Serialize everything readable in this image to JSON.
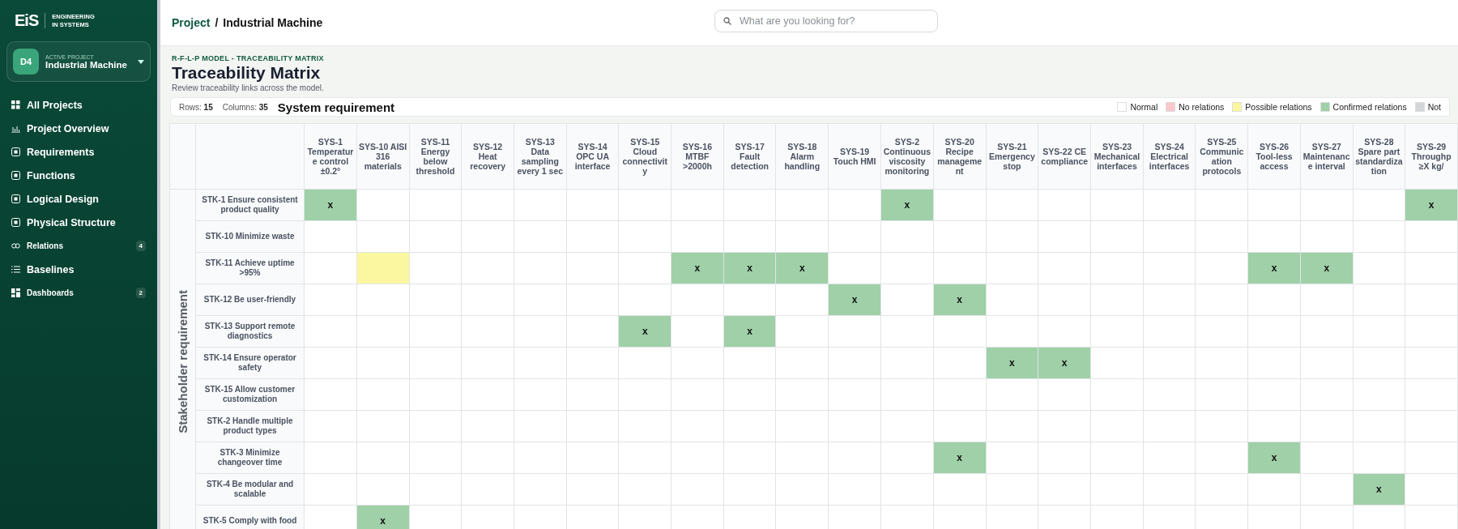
{
  "brand": {
    "logo": "EiS",
    "tagline_1": "ENGINEERING",
    "tagline_2": "IN SYSTEMS"
  },
  "project": {
    "avatar": "D4",
    "caption": "ACTIVE PROJECT",
    "name": "Industrial Machine"
  },
  "sidebar": {
    "items": [
      {
        "label": "All Projects",
        "kind": "main"
      },
      {
        "label": "Project Overview",
        "kind": "main"
      },
      {
        "label": "Requirements",
        "kind": "main"
      },
      {
        "label": "Functions",
        "kind": "main"
      },
      {
        "label": "Logical Design",
        "kind": "main"
      },
      {
        "label": "Physical Structure",
        "kind": "main"
      },
      {
        "label": "Relations",
        "kind": "compact",
        "badge": "4"
      },
      {
        "label": "Baselines",
        "kind": "main"
      },
      {
        "label": "Dashboards",
        "kind": "compact",
        "badge": "2"
      }
    ]
  },
  "breadcrumb": {
    "parent": "Project",
    "separator": "/",
    "current": "Industrial Machine"
  },
  "search": {
    "placeholder": "What are you looking for?"
  },
  "header": {
    "eyebrow": "R-F-L-P MODEL - TRACEABILITY MATRIX",
    "title": "Traceability Matrix",
    "subtitle": "Review traceability links across the model."
  },
  "toolbar": {
    "rows_label": "Rows:",
    "rows": "15",
    "columns_label": "Columns:",
    "columns": "35",
    "axis_title": "System requirement"
  },
  "legend": [
    {
      "label": "Normal",
      "color": "#ffffff"
    },
    {
      "label": "No relations",
      "color": "#f8c8cc"
    },
    {
      "label": "Possible relations",
      "color": "#fbf7a0"
    },
    {
      "label": "Confirmed relations",
      "color": "#9fd0a8"
    },
    {
      "label": "Not",
      "color": "#d4d6d8"
    }
  ],
  "matrix": {
    "row_axis": "Stakeholder requirement",
    "columns": [
      "SYS-1 Temperature control ±0.2°",
      "SYS-10 AISI 316 materials",
      "SYS-11 Energy below threshold",
      "SYS-12 Heat recovery",
      "SYS-13 Data sampling every 1 sec",
      "SYS-14 OPC UA interface",
      "SYS-15 Cloud connectivity",
      "SYS-16 MTBF >2000h",
      "SYS-17 Fault detection",
      "SYS-18 Alarm handling",
      "SYS-19 Touch HMI",
      "SYS-2 Continuous viscosity monitoring",
      "SYS-20 Recipe management",
      "SYS-21 Emergency stop",
      "SYS-22 CE compliance",
      "SYS-23 Mechanical interfaces",
      "SYS-24 Electrical interfaces",
      "SYS-25 Communication protocols",
      "SYS-26 Tool-less access",
      "SYS-27 Maintenance interval",
      "SYS-28 Spare part standardization",
      "SYS-29 Throughp ≥X kg/"
    ],
    "rows": [
      {
        "label": "STK-1 Ensure consistent product quality",
        "cells": [
          {
            "kind": "confirmed",
            "text": "x"
          },
          {
            "kind": "normal"
          },
          {
            "kind": "normal"
          },
          {
            "kind": "normal"
          },
          {
            "kind": "normal"
          },
          {
            "kind": "normal"
          },
          {
            "kind": "normal"
          },
          {
            "kind": "normal"
          },
          {
            "kind": "normal"
          },
          {
            "kind": "normal"
          },
          {
            "kind": "normal"
          },
          {
            "kind": "confirmed",
            "text": "x"
          },
          {
            "kind": "normal"
          },
          {
            "kind": "normal"
          },
          {
            "kind": "normal"
          },
          {
            "kind": "normal"
          },
          {
            "kind": "normal"
          },
          {
            "kind": "normal"
          },
          {
            "kind": "normal"
          },
          {
            "kind": "normal"
          },
          {
            "kind": "normal"
          },
          {
            "kind": "confirmed",
            "text": "x"
          }
        ]
      },
      {
        "label": "STK-10 Minimize waste",
        "cells": [
          {
            "kind": "normal"
          },
          {
            "kind": "normal"
          },
          {
            "kind": "normal"
          },
          {
            "kind": "normal"
          },
          {
            "kind": "normal"
          },
          {
            "kind": "normal"
          },
          {
            "kind": "normal"
          },
          {
            "kind": "normal"
          },
          {
            "kind": "normal"
          },
          {
            "kind": "normal"
          },
          {
            "kind": "normal"
          },
          {
            "kind": "normal"
          },
          {
            "kind": "normal"
          },
          {
            "kind": "normal"
          },
          {
            "kind": "normal"
          },
          {
            "kind": "normal"
          },
          {
            "kind": "normal"
          },
          {
            "kind": "normal"
          },
          {
            "kind": "normal"
          },
          {
            "kind": "normal"
          },
          {
            "kind": "normal"
          },
          {
            "kind": "normal"
          }
        ]
      },
      {
        "label": "STK-11 Achieve uptime >95%",
        "cells": [
          {
            "kind": "normal"
          },
          {
            "kind": "possible"
          },
          {
            "kind": "normal"
          },
          {
            "kind": "normal"
          },
          {
            "kind": "normal"
          },
          {
            "kind": "normal"
          },
          {
            "kind": "normal"
          },
          {
            "kind": "confirmed",
            "text": "x"
          },
          {
            "kind": "confirmed",
            "text": "x"
          },
          {
            "kind": "confirmed",
            "text": "x"
          },
          {
            "kind": "normal"
          },
          {
            "kind": "normal"
          },
          {
            "kind": "normal"
          },
          {
            "kind": "normal"
          },
          {
            "kind": "normal"
          },
          {
            "kind": "normal"
          },
          {
            "kind": "normal"
          },
          {
            "kind": "normal"
          },
          {
            "kind": "confirmed",
            "text": "x"
          },
          {
            "kind": "confirmed",
            "text": "x"
          },
          {
            "kind": "normal"
          },
          {
            "kind": "normal"
          }
        ]
      },
      {
        "label": "STK-12 Be user-friendly",
        "cells": [
          {
            "kind": "normal"
          },
          {
            "kind": "normal"
          },
          {
            "kind": "normal"
          },
          {
            "kind": "normal"
          },
          {
            "kind": "normal"
          },
          {
            "kind": "normal"
          },
          {
            "kind": "normal"
          },
          {
            "kind": "normal"
          },
          {
            "kind": "normal"
          },
          {
            "kind": "normal"
          },
          {
            "kind": "confirmed",
            "text": "x"
          },
          {
            "kind": "normal"
          },
          {
            "kind": "confirmed",
            "text": "x"
          },
          {
            "kind": "normal"
          },
          {
            "kind": "normal"
          },
          {
            "kind": "normal"
          },
          {
            "kind": "normal"
          },
          {
            "kind": "normal"
          },
          {
            "kind": "normal"
          },
          {
            "kind": "normal"
          },
          {
            "kind": "normal"
          },
          {
            "kind": "normal"
          }
        ]
      },
      {
        "label": "STK-13 Support remote diagnostics",
        "cells": [
          {
            "kind": "normal"
          },
          {
            "kind": "normal"
          },
          {
            "kind": "normal"
          },
          {
            "kind": "normal"
          },
          {
            "kind": "normal"
          },
          {
            "kind": "normal"
          },
          {
            "kind": "confirmed",
            "text": "x"
          },
          {
            "kind": "normal"
          },
          {
            "kind": "confirmed",
            "text": "x"
          },
          {
            "kind": "normal"
          },
          {
            "kind": "normal"
          },
          {
            "kind": "normal"
          },
          {
            "kind": "normal"
          },
          {
            "kind": "normal"
          },
          {
            "kind": "normal"
          },
          {
            "kind": "normal"
          },
          {
            "kind": "normal"
          },
          {
            "kind": "normal"
          },
          {
            "kind": "normal"
          },
          {
            "kind": "normal"
          },
          {
            "kind": "normal"
          },
          {
            "kind": "normal"
          }
        ]
      },
      {
        "label": "STK-14 Ensure operator safety",
        "cells": [
          {
            "kind": "normal"
          },
          {
            "kind": "normal"
          },
          {
            "kind": "normal"
          },
          {
            "kind": "normal"
          },
          {
            "kind": "normal"
          },
          {
            "kind": "normal"
          },
          {
            "kind": "normal"
          },
          {
            "kind": "normal"
          },
          {
            "kind": "normal"
          },
          {
            "kind": "normal"
          },
          {
            "kind": "normal"
          },
          {
            "kind": "normal"
          },
          {
            "kind": "normal"
          },
          {
            "kind": "confirmed",
            "text": "x"
          },
          {
            "kind": "confirmed",
            "text": "x"
          },
          {
            "kind": "normal"
          },
          {
            "kind": "normal"
          },
          {
            "kind": "normal"
          },
          {
            "kind": "normal"
          },
          {
            "kind": "normal"
          },
          {
            "kind": "normal"
          },
          {
            "kind": "normal"
          }
        ]
      },
      {
        "label": "STK-15 Allow customer customization",
        "cells": [
          {
            "kind": "normal"
          },
          {
            "kind": "normal"
          },
          {
            "kind": "normal"
          },
          {
            "kind": "normal"
          },
          {
            "kind": "normal"
          },
          {
            "kind": "normal"
          },
          {
            "kind": "normal"
          },
          {
            "kind": "normal"
          },
          {
            "kind": "normal"
          },
          {
            "kind": "normal"
          },
          {
            "kind": "normal"
          },
          {
            "kind": "normal"
          },
          {
            "kind": "normal"
          },
          {
            "kind": "normal"
          },
          {
            "kind": "normal"
          },
          {
            "kind": "normal"
          },
          {
            "kind": "normal"
          },
          {
            "kind": "normal"
          },
          {
            "kind": "normal"
          },
          {
            "kind": "normal"
          },
          {
            "kind": "normal"
          },
          {
            "kind": "normal"
          }
        ]
      },
      {
        "label": "STK-2 Handle multiple product types",
        "cells": [
          {
            "kind": "normal"
          },
          {
            "kind": "normal"
          },
          {
            "kind": "normal"
          },
          {
            "kind": "normal"
          },
          {
            "kind": "normal"
          },
          {
            "kind": "normal"
          },
          {
            "kind": "normal"
          },
          {
            "kind": "normal"
          },
          {
            "kind": "normal"
          },
          {
            "kind": "normal"
          },
          {
            "kind": "normal"
          },
          {
            "kind": "normal"
          },
          {
            "kind": "normal"
          },
          {
            "kind": "normal"
          },
          {
            "kind": "normal"
          },
          {
            "kind": "normal"
          },
          {
            "kind": "normal"
          },
          {
            "kind": "normal"
          },
          {
            "kind": "normal"
          },
          {
            "kind": "normal"
          },
          {
            "kind": "normal"
          },
          {
            "kind": "normal"
          }
        ]
      },
      {
        "label": "STK-3 Minimize changeover time",
        "cells": [
          {
            "kind": "normal"
          },
          {
            "kind": "normal"
          },
          {
            "kind": "normal"
          },
          {
            "kind": "normal"
          },
          {
            "kind": "normal"
          },
          {
            "kind": "normal"
          },
          {
            "kind": "normal"
          },
          {
            "kind": "normal"
          },
          {
            "kind": "normal"
          },
          {
            "kind": "normal"
          },
          {
            "kind": "normal"
          },
          {
            "kind": "normal"
          },
          {
            "kind": "confirmed",
            "text": "x"
          },
          {
            "kind": "normal"
          },
          {
            "kind": "normal"
          },
          {
            "kind": "normal"
          },
          {
            "kind": "normal"
          },
          {
            "kind": "normal"
          },
          {
            "kind": "confirmed",
            "text": "x"
          },
          {
            "kind": "normal"
          },
          {
            "kind": "normal"
          },
          {
            "kind": "normal"
          }
        ]
      },
      {
        "label": "STK-4 Be modular and scalable",
        "cells": [
          {
            "kind": "normal"
          },
          {
            "kind": "normal"
          },
          {
            "kind": "normal"
          },
          {
            "kind": "normal"
          },
          {
            "kind": "normal"
          },
          {
            "kind": "normal"
          },
          {
            "kind": "normal"
          },
          {
            "kind": "normal"
          },
          {
            "kind": "normal"
          },
          {
            "kind": "normal"
          },
          {
            "kind": "normal"
          },
          {
            "kind": "normal"
          },
          {
            "kind": "normal"
          },
          {
            "kind": "normal"
          },
          {
            "kind": "normal"
          },
          {
            "kind": "normal"
          },
          {
            "kind": "normal"
          },
          {
            "kind": "normal"
          },
          {
            "kind": "normal"
          },
          {
            "kind": "normal"
          },
          {
            "kind": "confirmed",
            "text": "x"
          },
          {
            "kind": "normal"
          }
        ]
      },
      {
        "label": "STK-5 Comply with food",
        "cells": [
          {
            "kind": "normal"
          },
          {
            "kind": "confirmed",
            "text": "x"
          },
          {
            "kind": "normal"
          },
          {
            "kind": "normal"
          },
          {
            "kind": "normal"
          },
          {
            "kind": "normal"
          },
          {
            "kind": "normal"
          },
          {
            "kind": "normal"
          },
          {
            "kind": "normal"
          },
          {
            "kind": "normal"
          },
          {
            "kind": "normal"
          },
          {
            "kind": "normal"
          },
          {
            "kind": "normal"
          },
          {
            "kind": "normal"
          },
          {
            "kind": "normal"
          },
          {
            "kind": "normal"
          },
          {
            "kind": "normal"
          },
          {
            "kind": "normal"
          },
          {
            "kind": "normal"
          },
          {
            "kind": "normal"
          },
          {
            "kind": "normal"
          },
          {
            "kind": "normal"
          }
        ]
      }
    ]
  }
}
